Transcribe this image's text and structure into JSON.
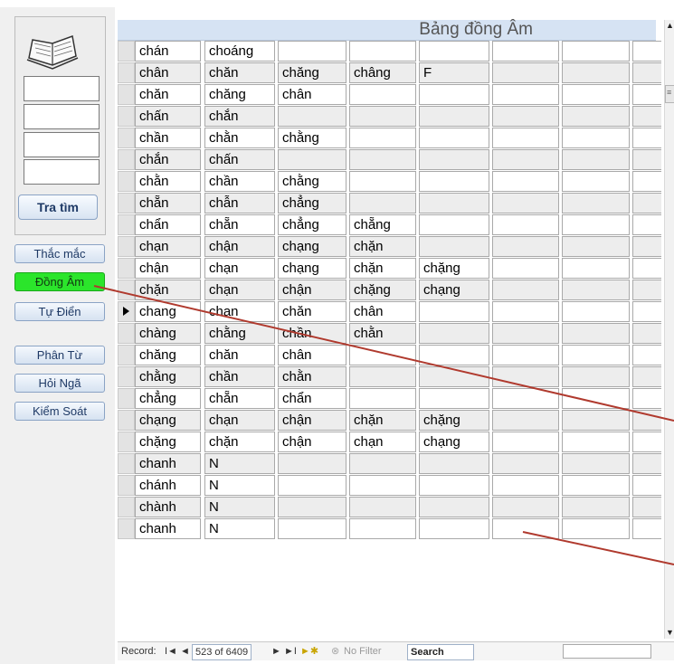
{
  "sidebar": {
    "search_button": "Tra tìm",
    "nav": [
      {
        "label": "Thắc mắc",
        "active": false
      },
      {
        "label": "Đồng Âm",
        "active": true
      },
      {
        "label": "Tự Điển",
        "active": false
      },
      {
        "label": "Phân Từ",
        "active": false
      },
      {
        "label": "Hỏi Ngã",
        "active": false
      },
      {
        "label": "Kiểm Soát",
        "active": false
      }
    ]
  },
  "form": {
    "title": "Bảng đồng Âm"
  },
  "rows": [
    [
      "chán",
      "choáng",
      "",
      "",
      "",
      "",
      "",
      ""
    ],
    [
      "chân",
      "chăn",
      "chăng",
      "châng",
      "F",
      "",
      "",
      ""
    ],
    [
      "chăn",
      "chăng",
      "chân",
      "",
      "",
      "",
      "",
      ""
    ],
    [
      "chấn",
      "chắn",
      "",
      "",
      "",
      "",
      "",
      ""
    ],
    [
      "chần",
      "chằn",
      "chằng",
      "",
      "",
      "",
      "",
      ""
    ],
    [
      "chắn",
      "chấn",
      "",
      "",
      "",
      "",
      "",
      ""
    ],
    [
      "chằn",
      "chần",
      "chằng",
      "",
      "",
      "",
      "",
      ""
    ],
    [
      "chẵn",
      "chẫn",
      "chẳng",
      "",
      "",
      "",
      "",
      ""
    ],
    [
      "chẩn",
      "chẵn",
      "chẳng",
      "chẵng",
      "",
      "",
      "",
      ""
    ],
    [
      "chạn",
      "chận",
      "chạng",
      "chặn",
      "",
      "",
      "",
      ""
    ],
    [
      "chận",
      "chạn",
      "chạng",
      "chặn",
      "chặng",
      "",
      "",
      ""
    ],
    [
      "chặn",
      "chạn",
      "chận",
      "chặng",
      "chạng",
      "",
      "",
      ""
    ],
    [
      "chang",
      "chan",
      "chăn",
      "chân",
      "",
      "",
      "",
      ""
    ],
    [
      "chàng",
      "chằng",
      "chần",
      "chằn",
      "",
      "",
      "",
      ""
    ],
    [
      "chăng",
      "chăn",
      "chân",
      "",
      "",
      "",
      "",
      ""
    ],
    [
      "chằng",
      "chần",
      "chằn",
      "",
      "",
      "",
      "",
      ""
    ],
    [
      "chẳng",
      "chẵn",
      "chẩn",
      "",
      "",
      "",
      "",
      ""
    ],
    [
      "chạng",
      "chạn",
      "chận",
      "chặn",
      "chặng",
      "",
      "",
      ""
    ],
    [
      "chặng",
      "chặn",
      "chận",
      "chạn",
      "chạng",
      "",
      "",
      ""
    ],
    [
      "chanh",
      "N",
      "",
      "",
      "",
      "",
      "",
      ""
    ],
    [
      "chánh",
      "N",
      "",
      "",
      "",
      "",
      "",
      ""
    ],
    [
      "chành",
      "N",
      "",
      "",
      "",
      "",
      "",
      ""
    ],
    [
      "chanh",
      "N",
      "",
      "",
      "",
      "",
      "",
      ""
    ]
  ],
  "current_row": 12,
  "navigation": {
    "record_label": "Record:",
    "first": "I◄",
    "prev": "◄",
    "position": "523 of 6409",
    "next": "►",
    "last": "►I",
    "new": "►✱",
    "filter": "No Filter",
    "search_placeholder": "Search"
  }
}
